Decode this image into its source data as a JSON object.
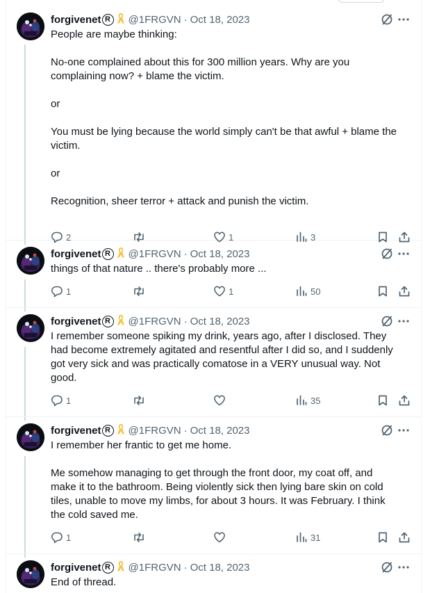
{
  "author": {
    "name": "forgivenet",
    "reg_mark": "R",
    "handle": "@1FRGVN",
    "separator": "·",
    "date": "Oct 18, 2023"
  },
  "colors": {
    "muted": "#536471",
    "ribbon": "#f6c343",
    "line": "#cfd9de"
  },
  "icons": {
    "reply": "speech-bubble",
    "retweet": "retweet-arrows",
    "like": "heart",
    "views": "bar-chart",
    "bookmark": "bookmark",
    "share": "share-upload",
    "grok": "slashed-circle",
    "more": "ellipsis"
  },
  "tweets": [
    {
      "lines": [
        "People are maybe thinking:",
        "",
        "No-one complained about this for 300 million years. Why are you",
        "complaining now? + blame the victim.",
        "",
        "or",
        "",
        "You must be lying because the world simply can't be that awful + blame the",
        "victim.",
        "",
        "or",
        "",
        "Recognition, sheer terror + attack and punish the victim."
      ],
      "replies": "2",
      "retweets": "",
      "likes": "1",
      "views": "3"
    },
    {
      "lines": [
        "things of that nature .. there's probably more ..."
      ],
      "replies": "1",
      "retweets": "",
      "likes": "1",
      "views": "50"
    },
    {
      "lines": [
        "I remember someone spiking my drink, years ago, after I disclosed. They",
        "had become extremely agitated and resentful after I did so, and I suddenly",
        "got very sick and was practically comatose in a VERY unusual way. Not",
        "good."
      ],
      "replies": "1",
      "retweets": "",
      "likes": "",
      "views": "35"
    },
    {
      "lines": [
        "I remember her frantic to get me home.",
        "",
        "Me somehow managing to get through the front door, my coat off, and",
        "make it to the bathroom. Being violently sick then lying bare skin on cold",
        "tiles, unable to move my limbs, for about 3 hours. It was February. I think",
        "the cold saved me."
      ],
      "replies": "1",
      "retweets": "",
      "likes": "",
      "views": "31"
    },
    {
      "lines": [
        "End of thread."
      ],
      "replies": "",
      "retweets": "",
      "likes": "",
      "views": ""
    }
  ]
}
